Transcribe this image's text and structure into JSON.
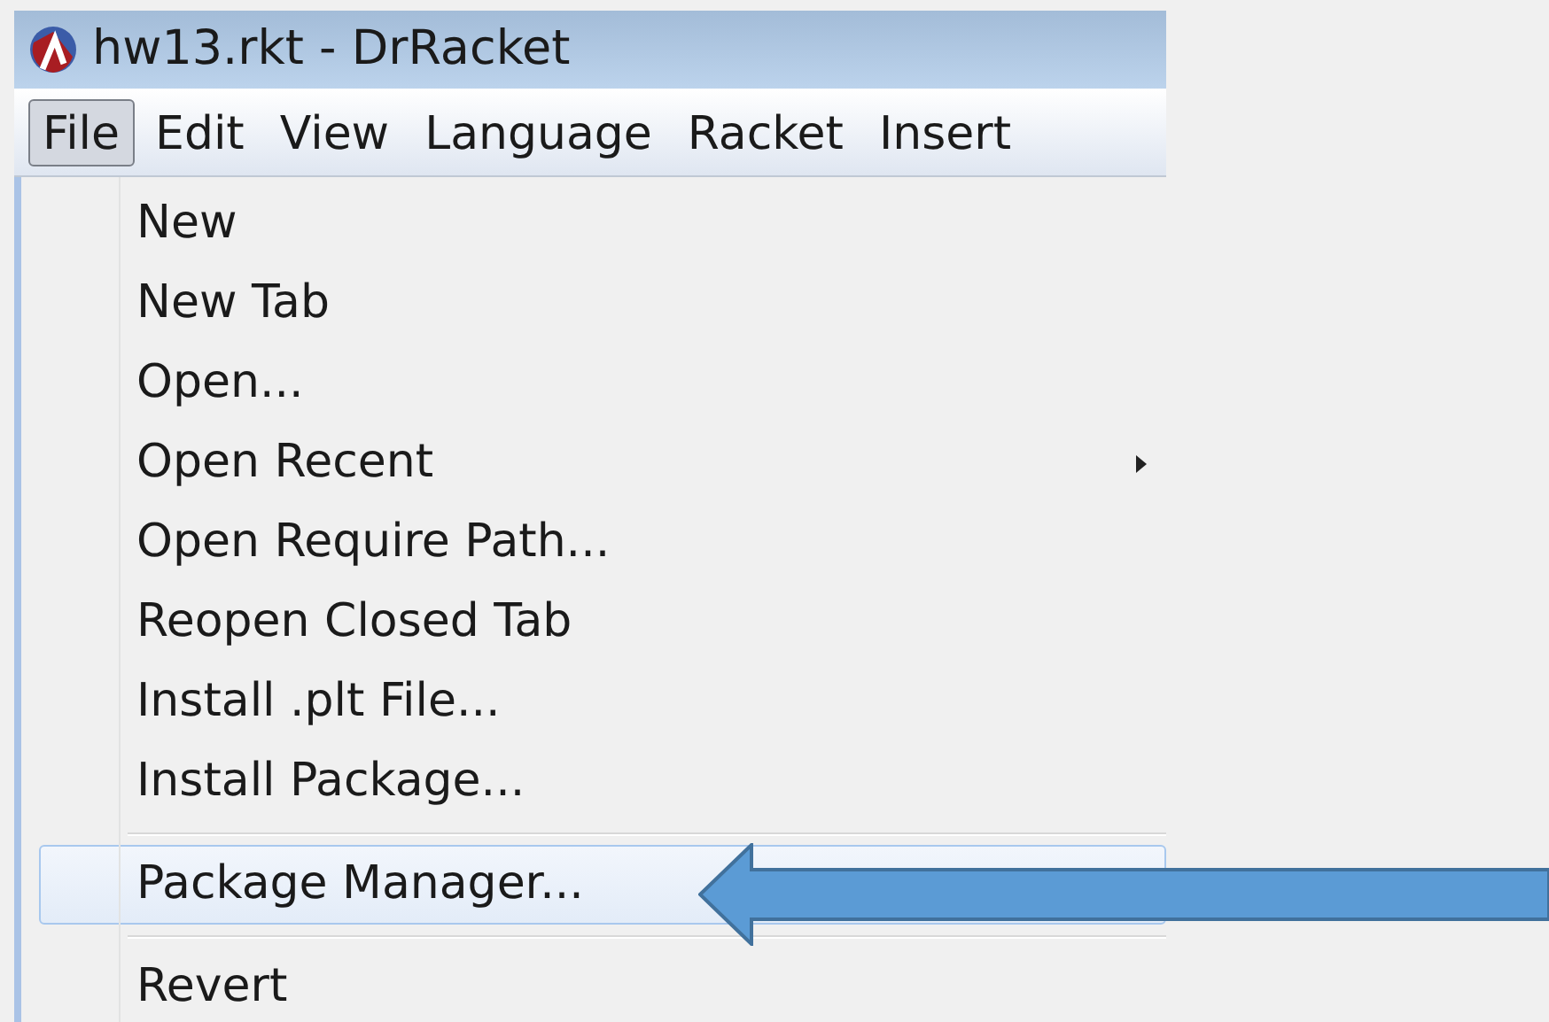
{
  "window": {
    "title": "hw13.rkt - DrRacket"
  },
  "menu_bar": [
    {
      "label": "File",
      "selected": true
    },
    {
      "label": "Edit",
      "selected": false
    },
    {
      "label": "View",
      "selected": false
    },
    {
      "label": "Language",
      "selected": false
    },
    {
      "label": "Racket",
      "selected": false
    },
    {
      "label": "Insert",
      "selected": false
    }
  ],
  "file_menu": [
    {
      "kind": "item",
      "label": "New",
      "selected": false,
      "has_submenu": false
    },
    {
      "kind": "item",
      "label": "New Tab",
      "selected": false,
      "has_submenu": false
    },
    {
      "kind": "item",
      "label": "Open...",
      "selected": false,
      "has_submenu": false
    },
    {
      "kind": "item",
      "label": "Open Recent",
      "selected": false,
      "has_submenu": true
    },
    {
      "kind": "item",
      "label": "Open Require Path...",
      "selected": false,
      "has_submenu": false
    },
    {
      "kind": "item",
      "label": "Reopen Closed Tab",
      "selected": false,
      "has_submenu": false
    },
    {
      "kind": "item",
      "label": "Install .plt File...",
      "selected": false,
      "has_submenu": false
    },
    {
      "kind": "item",
      "label": "Install Package...",
      "selected": false,
      "has_submenu": false
    },
    {
      "kind": "separator"
    },
    {
      "kind": "item",
      "label": "Package Manager...",
      "selected": true,
      "has_submenu": false
    },
    {
      "kind": "separator"
    },
    {
      "kind": "item",
      "label": "Revert",
      "selected": false,
      "has_submenu": false
    }
  ]
}
